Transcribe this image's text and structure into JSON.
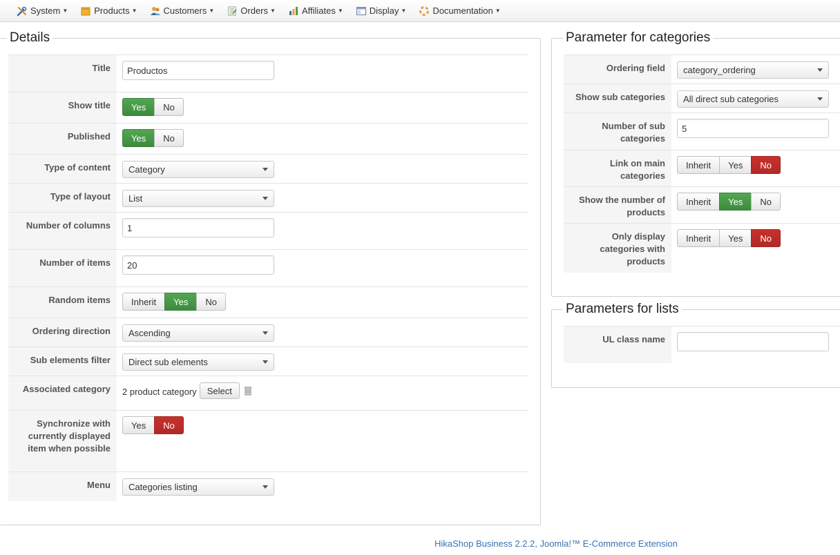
{
  "menu": [
    {
      "label": "System",
      "icon": "tools-icon"
    },
    {
      "label": "Products",
      "icon": "products-icon"
    },
    {
      "label": "Customers",
      "icon": "customers-icon"
    },
    {
      "label": "Orders",
      "icon": "orders-icon"
    },
    {
      "label": "Affiliates",
      "icon": "affiliates-icon"
    },
    {
      "label": "Display",
      "icon": "display-icon"
    },
    {
      "label": "Documentation",
      "icon": "documentation-icon"
    }
  ],
  "details": {
    "legend": "Details",
    "title_label": "Title",
    "title_value": "Productos",
    "show_title_label": "Show title",
    "published_label": "Published",
    "type_content_label": "Type of content",
    "type_content_value": "Category",
    "type_layout_label": "Type of layout",
    "type_layout_value": "List",
    "num_columns_label": "Number of columns",
    "num_columns_value": "1",
    "num_items_label": "Number of items",
    "num_items_value": "20",
    "random_items_label": "Random items",
    "ordering_direction_label": "Ordering direction",
    "ordering_direction_value": "Ascending",
    "sub_elements_label": "Sub elements filter",
    "sub_elements_value": "Direct sub elements",
    "assoc_category_label": "Associated category",
    "assoc_category_value": "2 product category",
    "select_button": "Select",
    "sync_label": "Synchronize with currently displayed item when possible",
    "menu_label": "Menu",
    "menu_value": "Categories listing"
  },
  "toggles": {
    "yes": "Yes",
    "no": "No",
    "inherit": "Inherit"
  },
  "categories": {
    "legend": "Parameter for categories",
    "ordering_field_label": "Ordering field",
    "ordering_field_value": "category_ordering",
    "show_sub_label": "Show sub categories",
    "show_sub_value": "All direct sub categories",
    "num_sub_label": "Number of sub categories",
    "num_sub_value": "5",
    "link_main_label": "Link on main categories",
    "show_number_label": "Show the number of products",
    "only_display_label": "Only display categories with products"
  },
  "lists": {
    "legend": "Parameters for lists",
    "ul_class_label": "UL class name",
    "ul_class_value": ""
  },
  "footer": "HikaShop Business 2.2.2, Joomla!™ E-Commerce Extension",
  "colors": {
    "active_yes": "#47a447",
    "active_no": "#bd2c27",
    "link": "#3a72b0"
  }
}
